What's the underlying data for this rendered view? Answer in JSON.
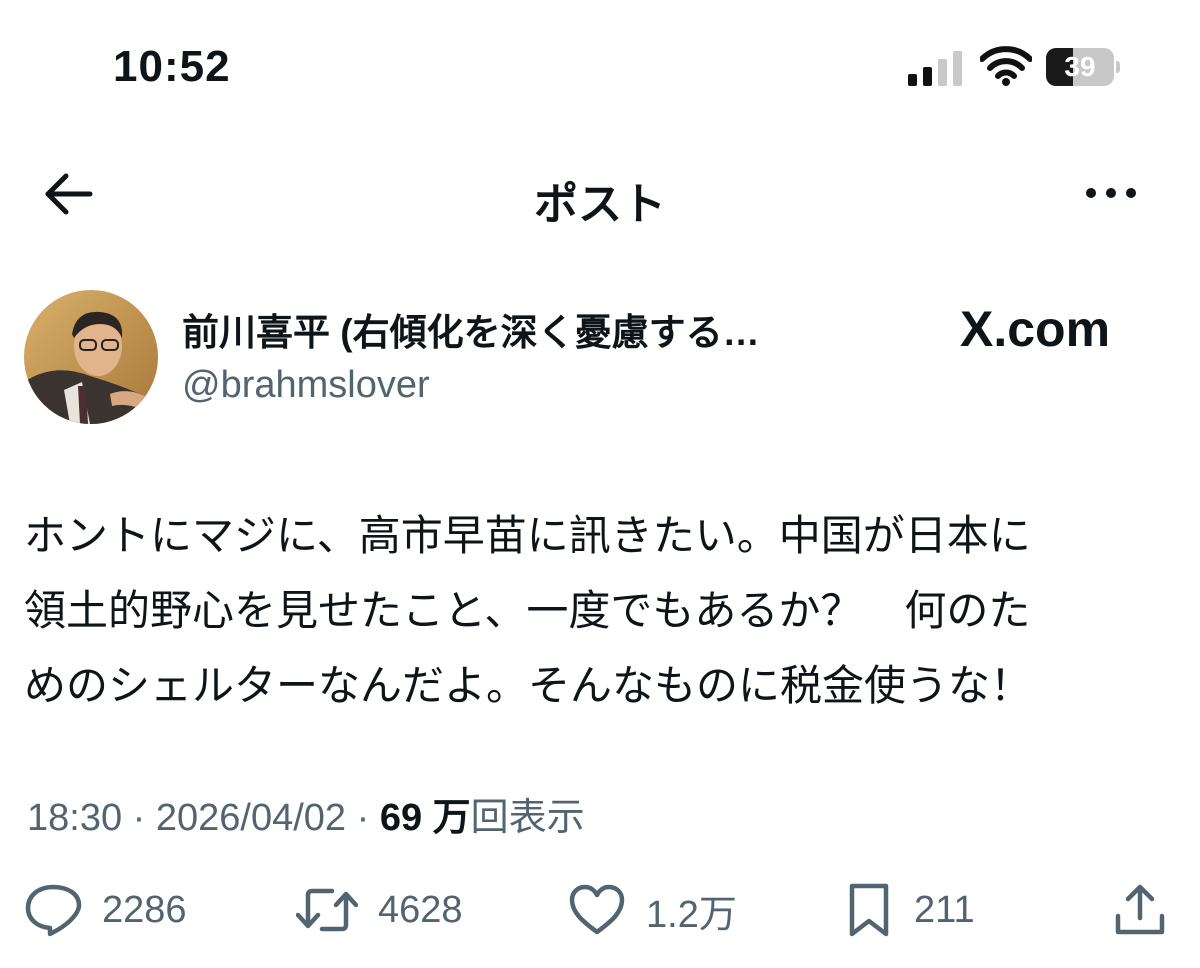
{
  "status_bar": {
    "time": "10:52",
    "battery_level": "39",
    "icons": [
      "signal-icon",
      "wifi-icon",
      "battery-icon"
    ]
  },
  "nav": {
    "title": "ポスト",
    "back_icon": "back-arrow-icon",
    "more_icon": "more-icon"
  },
  "author": {
    "name": "前川喜平 (右傾化を深く憂慮する…",
    "handle": "@brahmslover",
    "watermark": "X.com"
  },
  "post": {
    "lines": [
      "ホントにマジに、高市早苗に訊きたい。中国が日本に",
      "領土的野心を見せたこと、一度でもあるか？　何のた",
      "めのシェルターなんだよ。そんなものに税金使うな！"
    ]
  },
  "meta": {
    "time": "18:30",
    "separator": " · ",
    "date": "2026/04/02",
    "views": "69 万",
    "views_label": "回表示"
  },
  "actions": {
    "reply": {
      "icon": "reply-icon",
      "count": "2286"
    },
    "repost": {
      "icon": "repost-icon",
      "count": "4628"
    },
    "like": {
      "icon": "heart-icon",
      "count": "1.2万"
    },
    "bookmark": {
      "icon": "bookmark-icon",
      "count": "211"
    },
    "share": {
      "icon": "share-icon"
    }
  },
  "colors": {
    "text": "#0f1419",
    "secondary": "#536471",
    "background": "#ffffff"
  }
}
